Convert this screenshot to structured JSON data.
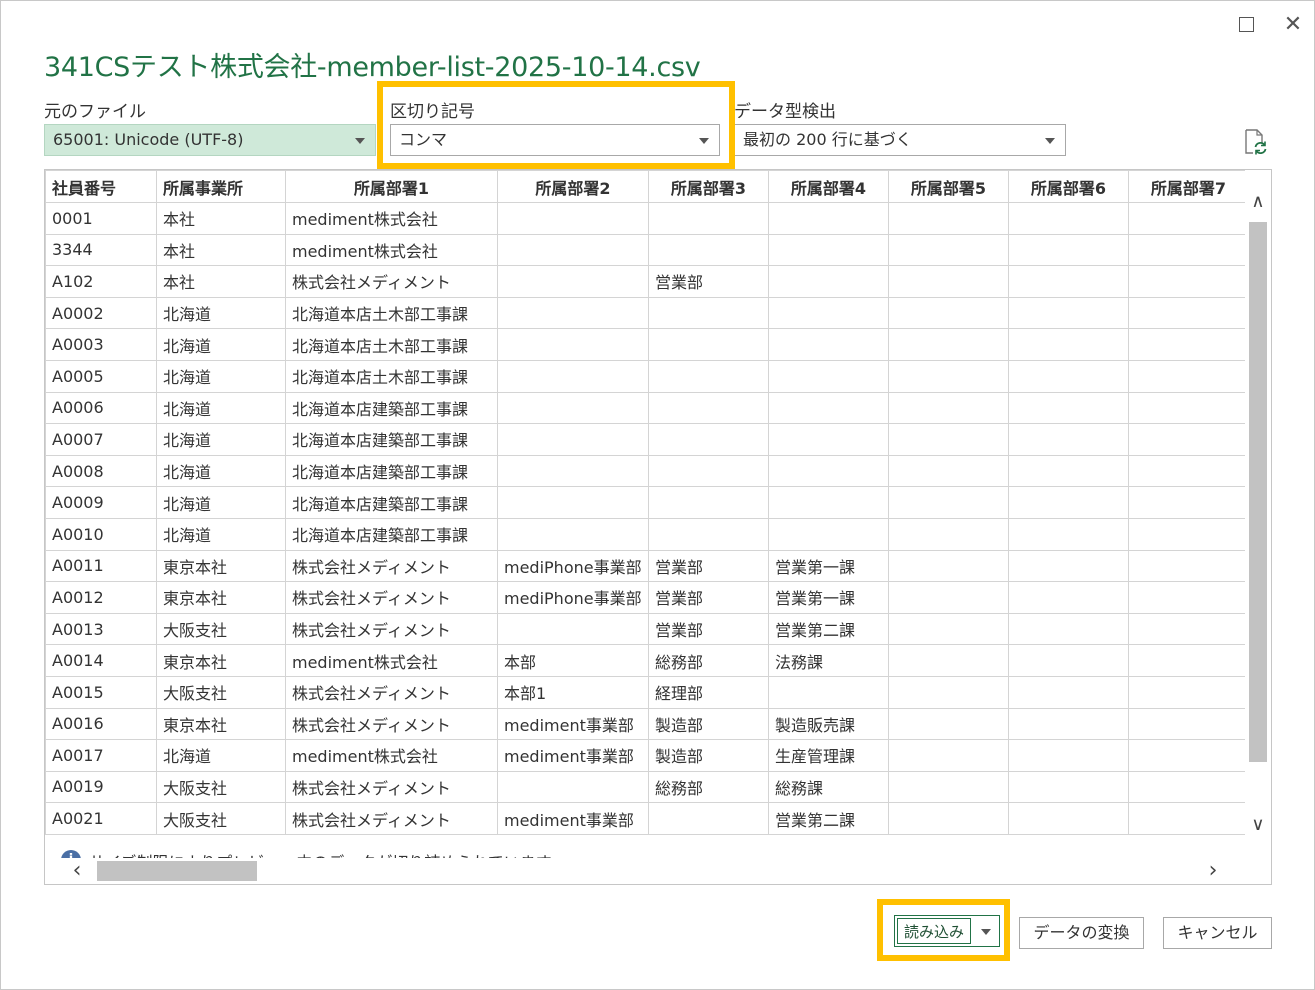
{
  "title": "341CSテスト株式会社-member-list-2025-10-14.csv",
  "window": {
    "maximize_icon": "maximize-icon",
    "close_label": "✕"
  },
  "file_origin": {
    "label": "元のファイル",
    "value": "65001: Unicode (UTF-8)"
  },
  "delimiter": {
    "label": "区切り記号",
    "value": "コンマ"
  },
  "data_type_detection": {
    "label": "データ型検出",
    "value": "最初の 200 行に基づく"
  },
  "colors": {
    "accent": "#217346",
    "highlight": "#ffc000",
    "selected_field": "#cfe9d9"
  },
  "grid": {
    "headers": [
      "社員番号",
      "所属事業所",
      "所属部署1",
      "所属部署2",
      "所属部署3",
      "所属部署4",
      "所属部署5",
      "所属部署6",
      "所属部署7"
    ],
    "rows": [
      [
        "0001",
        "本社",
        "mediment株式会社",
        "",
        "",
        "",
        "",
        "",
        ""
      ],
      [
        "3344",
        "本社",
        "mediment株式会社",
        "",
        "",
        "",
        "",
        "",
        ""
      ],
      [
        "A102",
        "本社",
        "株式会社メディメント",
        "",
        "営業部",
        "",
        "",
        "",
        ""
      ],
      [
        "A0002",
        "北海道",
        "北海道本店土木部工事課",
        "",
        "",
        "",
        "",
        "",
        ""
      ],
      [
        "A0003",
        "北海道",
        "北海道本店土木部工事課",
        "",
        "",
        "",
        "",
        "",
        ""
      ],
      [
        "A0005",
        "北海道",
        "北海道本店土木部工事課",
        "",
        "",
        "",
        "",
        "",
        ""
      ],
      [
        "A0006",
        "北海道",
        "北海道本店建築部工事課",
        "",
        "",
        "",
        "",
        "",
        ""
      ],
      [
        "A0007",
        "北海道",
        "北海道本店建築部工事課",
        "",
        "",
        "",
        "",
        "",
        ""
      ],
      [
        "A0008",
        "北海道",
        "北海道本店建築部工事課",
        "",
        "",
        "",
        "",
        "",
        ""
      ],
      [
        "A0009",
        "北海道",
        "北海道本店建築部工事課",
        "",
        "",
        "",
        "",
        "",
        ""
      ],
      [
        "A0010",
        "北海道",
        "北海道本店建築部工事課",
        "",
        "",
        "",
        "",
        "",
        ""
      ],
      [
        "A0011",
        "東京本社",
        "株式会社メディメント",
        "mediPhone事業部",
        "営業部",
        "営業第一課",
        "",
        "",
        ""
      ],
      [
        "A0012",
        "東京本社",
        "株式会社メディメント",
        "mediPhone事業部",
        "営業部",
        "営業第一課",
        "",
        "",
        ""
      ],
      [
        "A0013",
        "大阪支社",
        "株式会社メディメント",
        "",
        "営業部",
        "営業第二課",
        "",
        "",
        ""
      ],
      [
        "A0014",
        "東京本社",
        "mediment株式会社",
        "本部",
        "総務部",
        "法務課",
        "",
        "",
        ""
      ],
      [
        "A0015",
        "大阪支社",
        "株式会社メディメント",
        "本部1",
        "経理部",
        "",
        "",
        "",
        ""
      ],
      [
        "A0016",
        "東京本社",
        "株式会社メディメント",
        "mediment事業部",
        "製造部",
        "製造販売課",
        "",
        "",
        ""
      ],
      [
        "A0017",
        "北海道",
        "mediment株式会社",
        "mediment事業部",
        "製造部",
        "生産管理課",
        "",
        "",
        ""
      ],
      [
        "A0019",
        "大阪支社",
        "株式会社メディメント",
        "",
        "総務部",
        "総務課",
        "",
        "",
        ""
      ],
      [
        "A0021",
        "大阪支社",
        "株式会社メディメント",
        "mediment事業部",
        "",
        "営業第二課",
        "",
        "",
        ""
      ]
    ]
  },
  "info": {
    "icon": "info-icon",
    "text": "サイズ制限によりプレビュー内のデータが切り詰められています。"
  },
  "buttons": {
    "load": "読み込み",
    "transform": "データの変換",
    "cancel": "キャンセル"
  }
}
